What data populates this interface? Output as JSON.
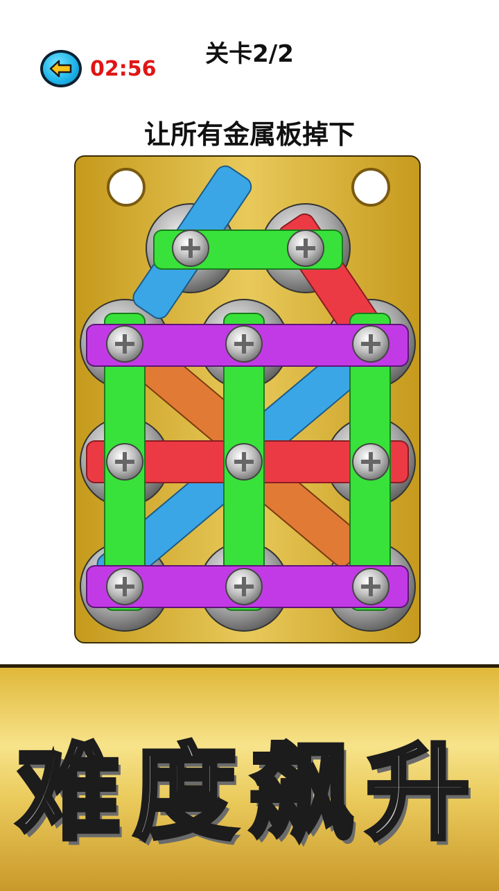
{
  "header": {
    "back_icon": "back-arrow-icon",
    "timer": "02:56",
    "level_label": "关卡2/2",
    "instruction": "让所有金属板掉下"
  },
  "colors": {
    "timer": "#e01515",
    "back_button": "#1eb2e8",
    "gold_board": "#d4aa2a",
    "green_plank": "#38e23a",
    "purple_plank": "#c23ae6",
    "red_plank": "#ec3a45",
    "blue_plank": "#3aa6e6",
    "orange_plank": "#e07a35"
  },
  "banner": {
    "text": "难度飙升"
  }
}
